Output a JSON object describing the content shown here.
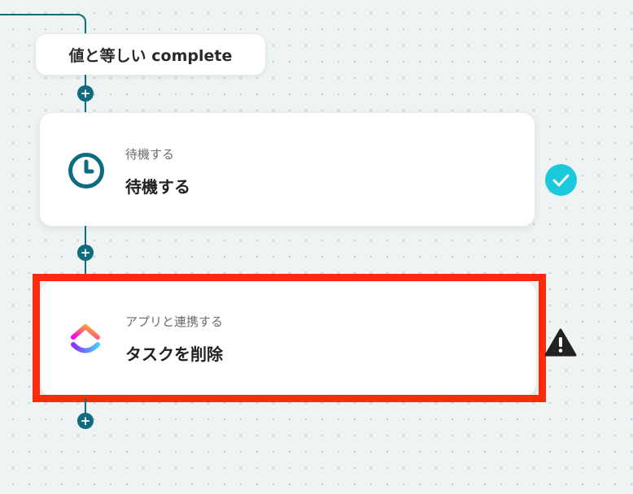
{
  "workflow": {
    "condition_pill": {
      "label": "値と等しい complete"
    },
    "steps": [
      {
        "type_label": "待機する",
        "title": "待機する",
        "icon": "clock-icon",
        "status": "complete",
        "status_icon": "check-circle-icon"
      },
      {
        "type_label": "アプリと連携する",
        "title": "タスクを削除",
        "icon": "clickup-logo-icon",
        "status": "warning",
        "status_icon": "warning-triangle-icon",
        "highlighted": true
      }
    ],
    "add_step_icon": "plus-icon"
  },
  "colors": {
    "connector": "#0f6b80",
    "highlight_border": "#ff2a0a",
    "success": "#1cc8dc",
    "warning": "#222222",
    "background": "#eef3f3"
  }
}
